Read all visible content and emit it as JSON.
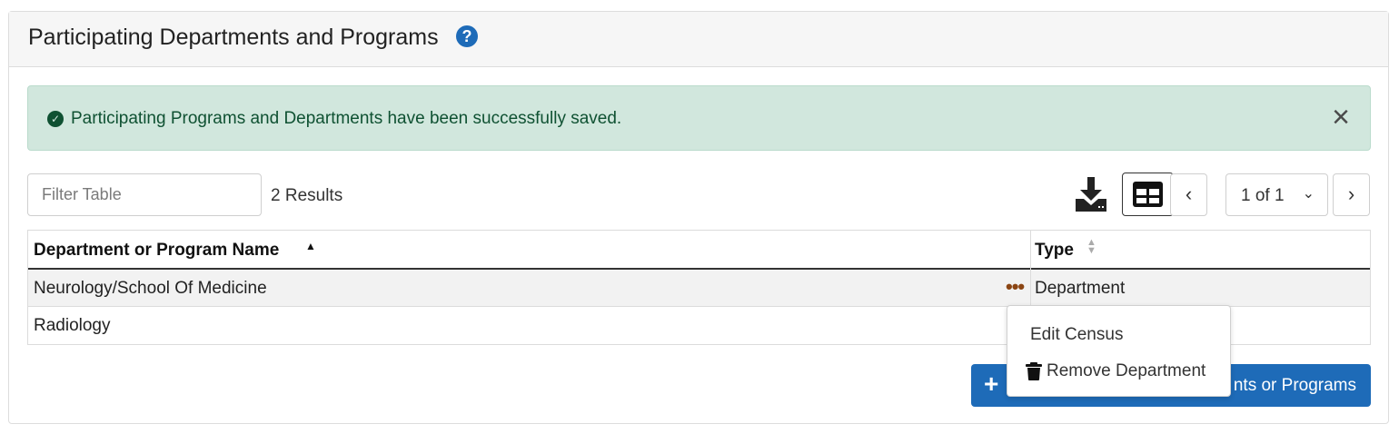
{
  "header": {
    "title": "Participating Departments and Programs",
    "help_icon": "?"
  },
  "alert": {
    "message": "Participating Programs and Departments have been successfully saved.",
    "close_icon": "×",
    "check_icon": "✓",
    "color": "#0f5132",
    "background": "#d1e7dd"
  },
  "toolbar": {
    "filter_placeholder": "Filter Table",
    "results": "2 Results",
    "prev_icon": "‹",
    "next_icon": "›",
    "page_label": "1 of 1",
    "page_chevron": "⌄"
  },
  "table": {
    "columns": [
      "Department or Program Name",
      "Type"
    ],
    "sort_asc_icon": "▲",
    "sort_both_icon": "▲▼",
    "rows": [
      {
        "name": "Neurology/School Of Medicine",
        "type": "Department"
      },
      {
        "name": "Radiology",
        "type": ""
      }
    ],
    "row_actions_icon": "•••"
  },
  "row_menu": {
    "items": [
      "Edit Census",
      "Remove Department"
    ]
  },
  "add_button": {
    "icon": "+",
    "label": "Add Participating Departments or Programs",
    "visible_label": "nts or Programs",
    "color": "#1e6bb8"
  },
  "colors": {
    "accent": "#1e6bb8",
    "actions": "#8b4513"
  }
}
